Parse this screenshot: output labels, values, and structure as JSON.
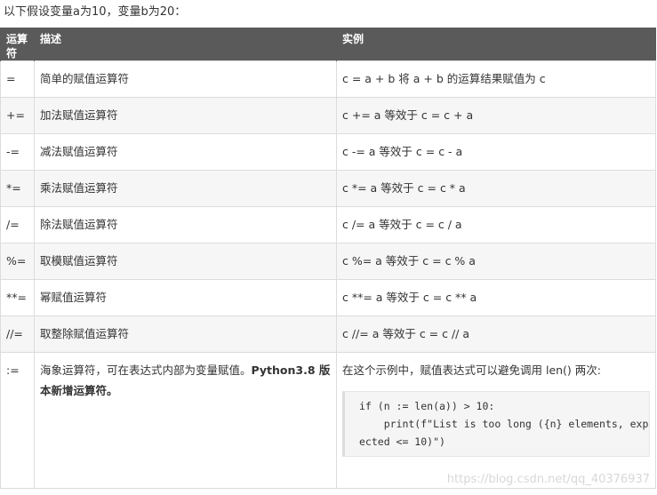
{
  "intro": "以下假设变量a为10，变量b为20：",
  "table": {
    "headers": [
      "运算符",
      "描述",
      "实例"
    ],
    "rows": [
      {
        "op": "=",
        "desc": "简单的赋值运算符",
        "example": "c = a + b 将 a + b 的运算结果赋值为 c"
      },
      {
        "op": "+=",
        "desc": "加法赋值运算符",
        "example": "c += a 等效于 c = c + a"
      },
      {
        "op": "-=",
        "desc": "减法赋值运算符",
        "example": "c -= a 等效于 c = c - a"
      },
      {
        "op": "*=",
        "desc": "乘法赋值运算符",
        "example": "c *= a 等效于 c = c * a"
      },
      {
        "op": "/=",
        "desc": "除法赋值运算符",
        "example": "c /= a 等效于 c = c / a"
      },
      {
        "op": "%=",
        "desc": "取模赋值运算符",
        "example": "c %= a 等效于 c = c % a"
      },
      {
        "op": "**=",
        "desc": "幂赋值运算符",
        "example": "c **= a 等效于 c = c ** a"
      },
      {
        "op": "//=",
        "desc": "取整除赋值运算符",
        "example": "c //= a 等效于 c = c // a"
      }
    ],
    "walrus": {
      "op": ":=",
      "desc": "海象运算符，可在表达式内部为变量赋值。",
      "desc_bold": "Python3.8 版本新增运算符。",
      "example": "在这个示例中，赋值表达式可以避免调用 len() 两次:",
      "code_lines": [
        "if (n := len(a)) > 10:",
        "    print(f\"List is too long ({n} elements, exp",
        "ected <= 10)\")"
      ]
    }
  },
  "watermark": "https://blog.csdn.net/qq_40376937"
}
